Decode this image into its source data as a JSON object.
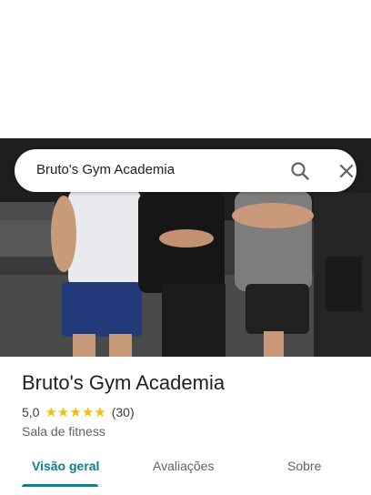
{
  "search": {
    "query": "Bruto's Gym Academia"
  },
  "place": {
    "name": "Bruto's Gym Academia",
    "rating": "5,0",
    "stars": 5,
    "review_count": "(30)",
    "category": "Sala de fitness"
  },
  "tabs": [
    {
      "label": "Visão geral",
      "active": true
    },
    {
      "label": "Avaliações",
      "active": false
    },
    {
      "label": "Sobre",
      "active": false
    }
  ],
  "colors": {
    "accent": "#0b7f8c",
    "star": "#fbbc04",
    "text": "#202124",
    "secondary_text": "#5f6368"
  }
}
